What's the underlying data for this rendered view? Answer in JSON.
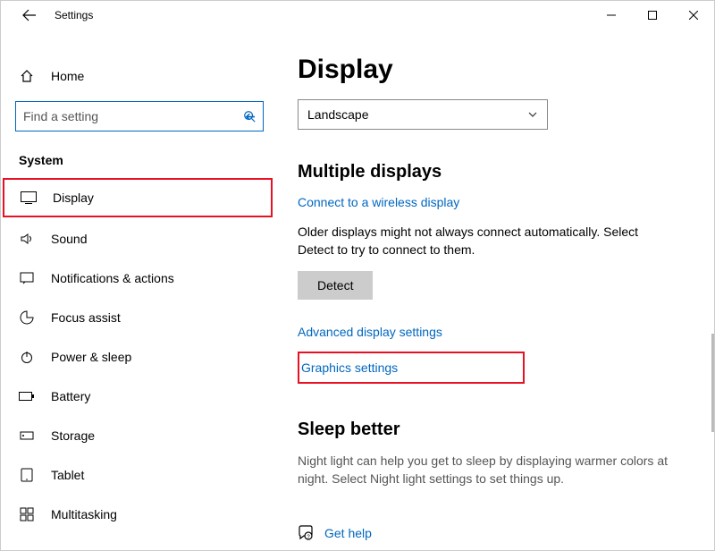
{
  "titlebar": {
    "title": "Settings"
  },
  "sidebar": {
    "home": "Home",
    "search_placeholder": "Find a setting",
    "section": "System",
    "items": [
      {
        "label": "Display"
      },
      {
        "label": "Sound"
      },
      {
        "label": "Notifications & actions"
      },
      {
        "label": "Focus assist"
      },
      {
        "label": "Power & sleep"
      },
      {
        "label": "Battery"
      },
      {
        "label": "Storage"
      },
      {
        "label": "Tablet"
      },
      {
        "label": "Multitasking"
      }
    ]
  },
  "main": {
    "title": "Display",
    "orientation": {
      "selected": "Landscape"
    },
    "multiple": {
      "heading": "Multiple displays",
      "connect_link": "Connect to a wireless display",
      "body": "Older displays might not always connect automatically. Select Detect to try to connect to them.",
      "detect": "Detect",
      "advanced_link": "Advanced display settings",
      "graphics_link": "Graphics settings"
    },
    "sleep": {
      "heading": "Sleep better",
      "body": "Night light can help you get to sleep by displaying warmer colors at night. Select Night light settings to set things up."
    },
    "gethelp": "Get help"
  }
}
